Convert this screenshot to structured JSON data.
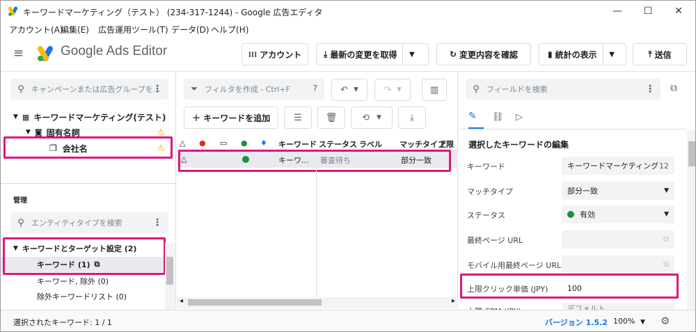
{
  "window": {
    "title": "キーワードマーケティング（テスト） (234-317-1244) - Google 広告エディタ",
    "minimize": "—",
    "maximize": "☐",
    "close": "✕"
  },
  "menu": [
    "アカウント(A)",
    "編集(E)",
    "広告運用ツール(T)",
    "データ(D)",
    "ヘルプ(H)"
  ],
  "header": {
    "brand": "Google Ads Editor",
    "account_btn": "アカウント",
    "get_changes_btn": "最新の変更を取得",
    "check_changes_btn": "変更内容を確認",
    "stats_btn": "統計の表示",
    "send_btn": "送信"
  },
  "left": {
    "search_placeholder": "キャンペーンまたは広告グループを...",
    "account": "キーワードマーケティング(テスト)",
    "campaign": "固有名詞",
    "adgroup": "会社名",
    "manage_title": "管理",
    "entity_search_placeholder": "エンティティタイプを検索",
    "section": "キーワードとターゲット設定 (2)",
    "items": [
      "キーワード (1)",
      "キーワード, 除外 (0)",
      "除外キーワードリスト (0)"
    ]
  },
  "mid": {
    "filter_placeholder": "フィルタを作成 - Ctrl+F",
    "add_keyword_btn": "キーワードを追加",
    "columns": [
      "キーワード",
      "ステータス",
      "ラベル",
      "マッチタイプ",
      "上限"
    ],
    "row": {
      "keyword": "キーワ...",
      "status": "審査待ち",
      "match": "部分一致"
    }
  },
  "right": {
    "search_placeholder": "フィールドを検索",
    "section_title": "選択したキーワードの編集",
    "fields": [
      {
        "label": "キーワード",
        "value": "キーワードマーケティング",
        "count": "12"
      },
      {
        "label": "マッチタイプ",
        "value": "部分一致"
      },
      {
        "label": "ステータス",
        "value": "有効"
      },
      {
        "label": "最終ページ URL",
        "value": ""
      },
      {
        "label": "モバイル用最終ページ URL",
        "value": ""
      },
      {
        "label": "上限クリック単価 (JPY)",
        "value": "100"
      },
      {
        "label": "上限 CPM (JPY)",
        "value": "デフォルト"
      }
    ]
  },
  "status": {
    "selected": "選択されたキーワード: 1 / 1",
    "version": "バージョン 1.5.2",
    "zoom": "100%"
  },
  "colors": {
    "highlight": "#e0157f",
    "google_blue": "#1a73e8",
    "google_yellow": "#fbbc04",
    "google_green": "#34a853",
    "status_green": "#1e8e3e",
    "warning": "#f9ab00"
  }
}
